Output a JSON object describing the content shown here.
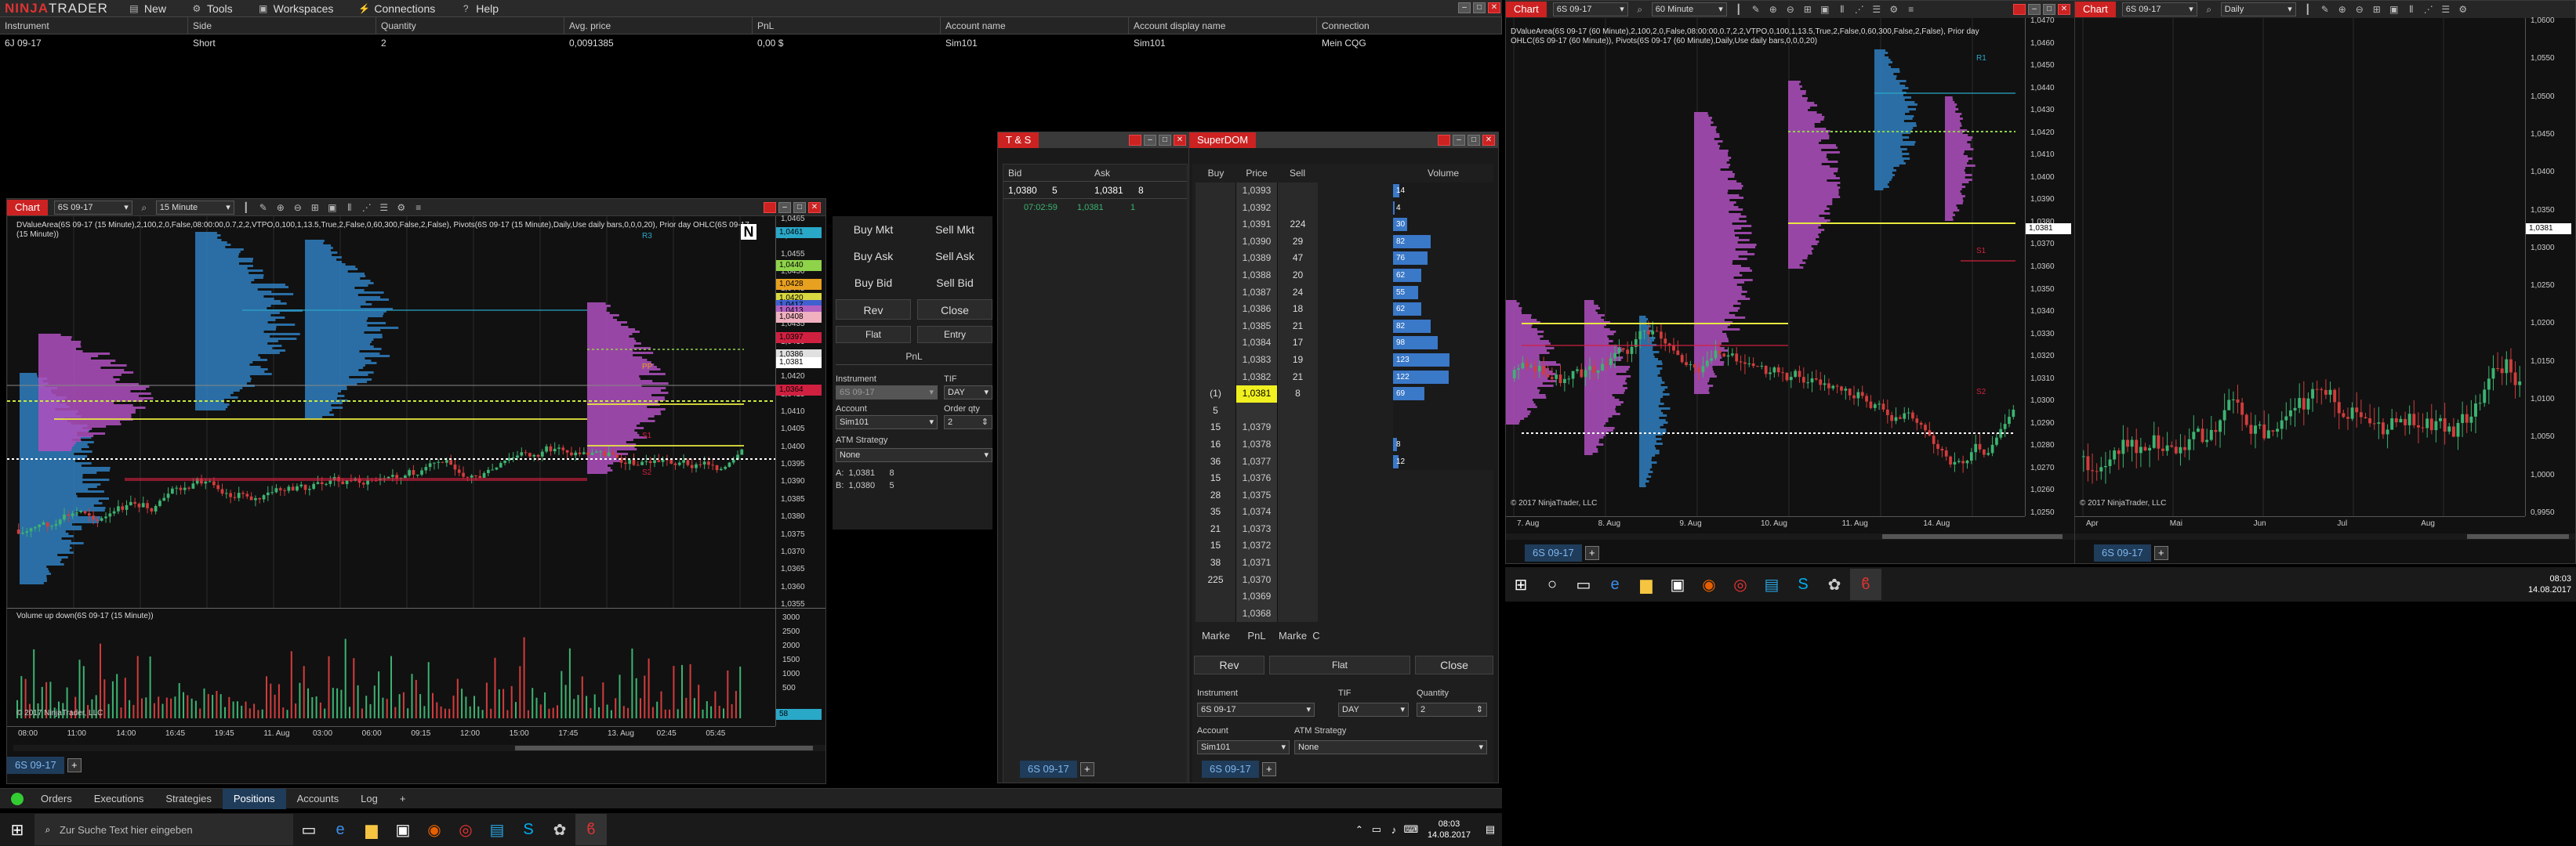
{
  "app": {
    "logo_a": "NINJA",
    "logo_b": "TRADER"
  },
  "menu": [
    {
      "label": "New",
      "icon": "file-icon"
    },
    {
      "label": "Tools",
      "icon": "gear-icon"
    },
    {
      "label": "Workspaces",
      "icon": "workspace-icon"
    },
    {
      "label": "Connections",
      "icon": "plug-icon"
    },
    {
      "label": "Help",
      "icon": "help-icon"
    }
  ],
  "positions": {
    "headers": [
      "Instrument",
      "Side",
      "Quantity",
      "Avg. price",
      "PnL",
      "Account name",
      "Account display name",
      "Connection"
    ],
    "row": [
      "6J 09-17",
      "Short",
      "2",
      "0,0091385",
      "0,00 $",
      "Sim101",
      "Sim101",
      "Mein CQG"
    ]
  },
  "chart_left": {
    "tab": "Chart",
    "instrument": "6S 09-17",
    "interval": "15 Minute",
    "indicator_text": "DValueArea(6S 09-17 (15 Minute),2,100,2,0,False,08:00:00,0.7,2,2,VTPO,0,100,1,13.5,True,2,False,0,60,300,False,2,False), Pivots(6S 09-17 (15 Minute),Daily,Use daily bars,0,0,0,20), Prior day OHLC(6S 09-17 (15 Minute))",
    "copyright": "© 2017 NinjaTrader, LLC",
    "volume_title": "Volume up down(6S 09-17 (15 Minute))",
    "price_ticks": [
      "1,0465",
      "1,0460",
      "1,0455",
      "1,0450",
      "1,0445",
      "1,0440",
      "1,0435",
      "1,0430",
      "1,0425",
      "1,0420",
      "1,0415",
      "1,0410",
      "1,0405",
      "1,0400",
      "1,0395",
      "1,0390",
      "1,0385",
      "1,0380",
      "1,0375",
      "1,0370",
      "1,0365",
      "1,0360",
      "1,0355"
    ],
    "price_tags": [
      {
        "text": "1,0461",
        "color": "#2aa8c8"
      },
      {
        "text": "1,0440",
        "color": "#8fd34a"
      },
      {
        "text": "1,0428",
        "color": "#e8a020"
      },
      {
        "text": "1,0420",
        "color": "#d8d840"
      },
      {
        "text": "1,0417",
        "color": "#4060d0"
      },
      {
        "text": "1,0413",
        "color": "#b060c0"
      },
      {
        "text": "1,0408",
        "color": "#f0b0c0"
      },
      {
        "text": "1,0397",
        "color": "#d02040"
      },
      {
        "text": "1,0386",
        "color": "#e0e0e0"
      },
      {
        "text": "1,0381",
        "color": "#ffffff"
      },
      {
        "text": "1,0364",
        "color": "#d02040"
      }
    ],
    "level_labels": [
      "R3",
      "PP",
      "S1",
      "S2"
    ],
    "vol_ticks": [
      "3000",
      "2500",
      "2000",
      "1500",
      "1000",
      "500"
    ],
    "vol_tag": "58",
    "time_labels": [
      "08:00",
      "11:00",
      "14:00",
      "16:45",
      "19:45",
      "11. Aug",
      "03:00",
      "06:00",
      "09:15",
      "12:00",
      "15:00",
      "17:45",
      "13. Aug",
      "02:45",
      "05:45"
    ],
    "bottom_tab": "6S 09-17"
  },
  "chart_trader": {
    "buttons": [
      "Buy Mkt",
      "Sell Mkt",
      "Buy Ask",
      "Sell Ask",
      "Buy Bid",
      "Sell Bid",
      "Rev",
      "Close",
      "Flat",
      "Entry"
    ],
    "pnl_label": "PnL",
    "instrument_label": "Instrument",
    "instrument_value": "6S 09-17",
    "tif_label": "TIF",
    "tif_value": "DAY",
    "account_label": "Account",
    "account_value": "Sim101",
    "qty_label": "Order qty",
    "qty_value": "2",
    "atm_label": "ATM Strategy",
    "atm_value": "None",
    "ask_line": "A:  1,0381      8",
    "bid_line": "B:  1,0380      5"
  },
  "ts": {
    "title": "T & S",
    "headers": [
      "Bid",
      "Ask"
    ],
    "row1": [
      "1,0380",
      "5",
      "1,0381",
      "8"
    ],
    "row2": [
      "07:02:59",
      "1,0381",
      "1"
    ],
    "bottom_tab": "6S 09-17"
  },
  "superdom": {
    "title": "SuperDOM",
    "headers": [
      "Buy",
      "Price",
      "Sell"
    ],
    "vol_header": "Volume",
    "rows": [
      {
        "buy": "",
        "price": "1,0393",
        "sell": ""
      },
      {
        "buy": "",
        "price": "1,0392",
        "sell": ""
      },
      {
        "buy": "",
        "price": "1,0391",
        "sell": "224"
      },
      {
        "buy": "",
        "price": "1,0390",
        "sell": "29"
      },
      {
        "buy": "",
        "price": "1,0389",
        "sell": "47"
      },
      {
        "buy": "",
        "price": "1,0388",
        "sell": "20"
      },
      {
        "buy": "",
        "price": "1,0387",
        "sell": "24"
      },
      {
        "buy": "",
        "price": "1,0386",
        "sell": "18"
      },
      {
        "buy": "",
        "price": "1,0385",
        "sell": "21"
      },
      {
        "buy": "",
        "price": "1,0384",
        "sell": "17"
      },
      {
        "buy": "",
        "price": "1,0383",
        "sell": "19"
      },
      {
        "buy": "",
        "price": "1,0382",
        "sell": "21"
      },
      {
        "buy": "(1)",
        "price": "1,0381",
        "sell": "8"
      },
      {
        "buy": "5",
        "price": "",
        "sell": ""
      },
      {
        "buy": "15",
        "price": "1,0379",
        "sell": ""
      },
      {
        "buy": "16",
        "price": "1,0378",
        "sell": ""
      },
      {
        "buy": "36",
        "price": "1,0377",
        "sell": ""
      },
      {
        "buy": "15",
        "price": "1,0376",
        "sell": ""
      },
      {
        "buy": "28",
        "price": "1,0375",
        "sell": ""
      },
      {
        "buy": "35",
        "price": "1,0374",
        "sell": ""
      },
      {
        "buy": "21",
        "price": "1,0373",
        "sell": ""
      },
      {
        "buy": "15",
        "price": "1,0372",
        "sell": ""
      },
      {
        "buy": "38",
        "price": "1,0371",
        "sell": ""
      },
      {
        "buy": "225",
        "price": "1,0370",
        "sell": ""
      },
      {
        "buy": "",
        "price": "1,0369",
        "sell": ""
      },
      {
        "buy": "",
        "price": "1,0368",
        "sell": ""
      }
    ],
    "volumes": [
      "14",
      "4",
      "30",
      "82",
      "76",
      "62",
      "55",
      "62",
      "82",
      "98",
      "123",
      "122",
      "69",
      "",
      "",
      "8",
      "12"
    ],
    "volume_values": [
      14,
      4,
      30,
      82,
      76,
      62,
      55,
      62,
      82,
      98,
      123,
      122,
      69,
      0,
      0,
      8,
      12
    ],
    "foot": [
      "Marke",
      "PnL",
      "Marke",
      "C"
    ],
    "buttons": [
      "Rev",
      "Flat",
      "Close"
    ],
    "instrument_label": "Instrument",
    "instrument_value": "6S 09-17",
    "tif_label": "TIF",
    "tif_value": "DAY",
    "qty_label": "Quantity",
    "qty_value": "2",
    "account_label": "Account",
    "account_value": "Sim101",
    "atm_label": "ATM Strategy",
    "atm_value": "None",
    "bottom_tab": "6S 09-17"
  },
  "chart_mid": {
    "tab": "Chart",
    "instrument": "6S 09-17",
    "interval": "60 Minute",
    "indicator_text": "DValueArea(6S 09-17 (60 Minute),2,100,2,0,False,08:00:00,0.7,2,2,VTPO,0,100,1,13.5,True,2,False,0,60,300,False,2,False), Prior day OHLC(6S 09-17 (60 Minute)), Pivots(6S 09-17 (60 Minute),Daily,Use daily bars,0,0,0,20)",
    "copyright": "© 2017 NinjaTrader, LLC",
    "price_ticks": [
      "1,0470",
      "1,0460",
      "1,0450",
      "1,0440",
      "1,0430",
      "1,0420",
      "1,0410",
      "1,0400",
      "1,0390",
      "1,0380",
      "1,0370",
      "1,0360",
      "1,0350",
      "1,0340",
      "1,0330",
      "1,0320",
      "1,0310",
      "1,0300",
      "1,0290",
      "1,0280",
      "1,0270",
      "1,0260",
      "1,0250"
    ],
    "current": "1,0381",
    "level_labels": [
      "R1",
      "S1",
      "S2"
    ],
    "time_labels": [
      "7. Aug",
      "8. Aug",
      "9. Aug",
      "10. Aug",
      "11. Aug",
      "14. Aug"
    ],
    "bottom_tab": "6S 09-17"
  },
  "chart_right": {
    "tab": "Chart",
    "instrument": "6S 09-17",
    "interval": "Daily",
    "copyright": "© 2017 NinjaTrader, LLC",
    "price_ticks": [
      "1,0600",
      "1,0550",
      "1,0500",
      "1,0450",
      "1,0400",
      "1,0350",
      "1,0300",
      "1,0250",
      "1,0200",
      "1,0150",
      "1,0100",
      "1,0050",
      "1,0000",
      "0,9950"
    ],
    "current": "1,0381",
    "time_labels": [
      "Apr",
      "Mai",
      "Jun",
      "Jul",
      "Aug"
    ],
    "bottom_tab": "6S 09-17"
  },
  "bottom_tabs": [
    "Orders",
    "Executions",
    "Strategies",
    "Positions",
    "Accounts",
    "Log"
  ],
  "taskbar": {
    "search_placeholder": "Zur Suche Text hier eingeben",
    "time": "08:03",
    "date": "14.08.2017"
  },
  "taskbar2": {
    "time": "08:03",
    "date": "14.08.2017"
  },
  "colors": {
    "accent": "#c22222",
    "bull": "#3cb371",
    "bear": "#d23c3c",
    "profile_blue": "#2f7fc0",
    "profile_purple": "#b050c0"
  }
}
